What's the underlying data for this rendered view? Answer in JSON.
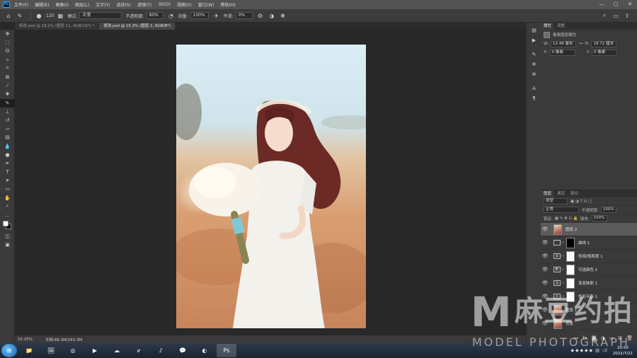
{
  "menu": {
    "logo": "Ps",
    "items": [
      "文件(F)",
      "编辑(E)",
      "图像(I)",
      "图层(L)",
      "文字(Y)",
      "选择(S)",
      "滤镜(T)",
      "3D(D)",
      "视图(V)",
      "窗口(W)",
      "帮助(H)"
    ]
  },
  "window_controls": [
    "—",
    "▢",
    "✕"
  ],
  "options": {
    "brush_size": "120",
    "mode_label": "模式:",
    "mode_value": "正常",
    "opacity_label": "不透明度:",
    "opacity_value": "80%",
    "flow_label": "流量:",
    "flow_value": "100%",
    "smoothing_label": "平滑:",
    "smoothing_value": "0%"
  },
  "tabs": [
    {
      "label": "修改.psd @ 18.2% (图层 11, RGB/16*) *",
      "active": false
    },
    {
      "label": "修改.psd @ 15.3% (图层 2, RGB/8*)",
      "active": true
    }
  ],
  "status": {
    "zoom": "15.25%",
    "doc": "文档:66.3M/183.3M"
  },
  "properties": {
    "tabs": [
      "属性",
      "调整"
    ],
    "title": "像素图层属性",
    "w_label": "W:",
    "w_value": "12.48 厘米",
    "h_label": "H:",
    "h_value": "18.72 厘米",
    "x_label": "X:",
    "x_value": "0 像素",
    "y_label": "Y:",
    "y_value": "0 像素"
  },
  "layers": {
    "tabs": [
      "图层",
      "通道",
      "路径"
    ],
    "kind": "类型",
    "blend": "正常",
    "opacity_label": "不透明度:",
    "opacity_value": "100%",
    "lock_label": "锁定:",
    "fill_label": "填充:",
    "fill_value": "100%",
    "items": [
      {
        "name": "图层 2",
        "thumb": "photo",
        "selected": true
      },
      {
        "name": "曲线 1",
        "thumb": "black",
        "selected": false
      },
      {
        "name": "色相/饱和度 1",
        "thumb": "white",
        "selected": false
      },
      {
        "name": "可选颜色 1",
        "thumb": "white",
        "selected": false
      },
      {
        "name": "渐变映射 1",
        "thumb": "white",
        "selected": false
      },
      {
        "name": "色彩平衡 1",
        "thumb": "white",
        "selected": false
      },
      {
        "name": "图层 1",
        "thumb": "photo",
        "selected": false
      },
      {
        "name": "背景",
        "thumb": "photo",
        "selected": false
      }
    ]
  },
  "taskbar": {
    "apps": [
      "📁",
      "🖼",
      "◎",
      "▶",
      "☁",
      "ℯ",
      "♪",
      "💬",
      "◐",
      "Ps"
    ],
    "time": "20:50",
    "date": "2021/7/21"
  },
  "watermark": {
    "letter": "M",
    "cn": "麻豆约拍",
    "en": "MODEL PHOTOGRAPH"
  }
}
